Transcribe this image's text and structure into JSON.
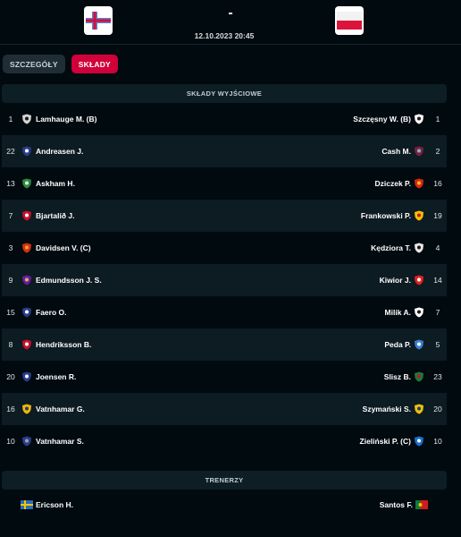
{
  "match": {
    "score": "-",
    "datetime": "12.10.2023 20:45",
    "home_flag_icon": "faroe-islands-flag",
    "away_flag_icon": "poland-flag"
  },
  "tabs": [
    {
      "label": "SZCZEGÓŁY",
      "active": false
    },
    {
      "label": "SKŁADY",
      "active": true
    }
  ],
  "lineups": {
    "title": "SKŁADY WYJŚCIOWE",
    "rows": [
      {
        "home_num": "1",
        "home_name": "Lamhauge M. (B)",
        "home_crest": "club-crest-icon",
        "away_name": "Szczęsny W. (B)",
        "away_num": "1",
        "away_crest": "club-crest-icon"
      },
      {
        "home_num": "22",
        "home_name": "Andreasen J.",
        "home_crest": "club-crest-icon",
        "away_name": "Cash M.",
        "away_num": "2",
        "away_crest": "club-crest-icon"
      },
      {
        "home_num": "13",
        "home_name": "Askham H.",
        "home_crest": "club-crest-icon",
        "away_name": "Dziczek P.",
        "away_num": "16",
        "away_crest": "club-crest-icon"
      },
      {
        "home_num": "7",
        "home_name": "Bjartalíð J.",
        "home_crest": "club-crest-icon",
        "away_name": "Frankowski P.",
        "away_num": "19",
        "away_crest": "club-crest-icon"
      },
      {
        "home_num": "3",
        "home_name": "Davidsen V. (C)",
        "home_crest": "club-crest-icon",
        "away_name": "Kędziora T.",
        "away_num": "4",
        "away_crest": "club-crest-icon"
      },
      {
        "home_num": "9",
        "home_name": "Edmundsson J. S.",
        "home_crest": "club-crest-icon",
        "away_name": "Kiwior J.",
        "away_num": "14",
        "away_crest": "club-crest-icon"
      },
      {
        "home_num": "15",
        "home_name": "Faero O.",
        "home_crest": "club-crest-icon",
        "away_name": "Milik A.",
        "away_num": "7",
        "away_crest": "club-crest-icon"
      },
      {
        "home_num": "8",
        "home_name": "Hendriksson B.",
        "home_crest": "club-crest-icon",
        "away_name": "Peda P.",
        "away_num": "5",
        "away_crest": "club-crest-icon"
      },
      {
        "home_num": "20",
        "home_name": "Joensen R.",
        "home_crest": "club-crest-icon",
        "away_name": "Slisz B.",
        "away_num": "23",
        "away_crest": "club-crest-icon"
      },
      {
        "home_num": "16",
        "home_name": "Vatnhamar G.",
        "home_crest": "club-crest-icon",
        "away_name": "Szymański S.",
        "away_num": "20",
        "away_crest": "club-crest-icon"
      },
      {
        "home_num": "10",
        "home_name": "Vatnhamar S.",
        "home_crest": "club-crest-icon",
        "away_name": "Zieliński P. (C)",
        "away_num": "10",
        "away_crest": "club-crest-icon"
      }
    ]
  },
  "coaches": {
    "title": "TRENERZY",
    "home_name": "Ericson H.",
    "home_flag_icon": "sweden-flag",
    "away_name": "Santos F.",
    "away_flag_icon": "portugal-flag"
  },
  "colors": {
    "background": "#010a0f",
    "accent": "#d1003a",
    "row_shade": "#0d1b22"
  }
}
